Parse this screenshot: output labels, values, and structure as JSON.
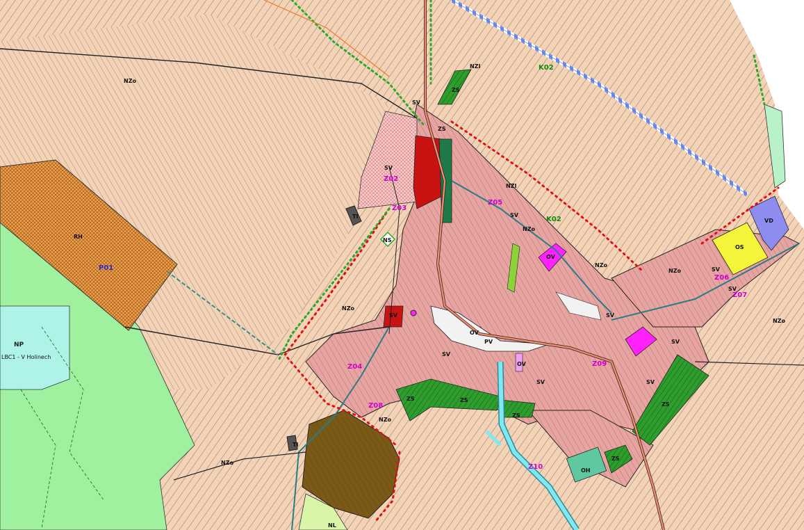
{
  "colors": {
    "agricultural": "#f3d2b6",
    "village": "#e8a4a0",
    "village_dense": "#e07b7b",
    "green_dark": "#2e9d2e",
    "green_light": "#9ff09f",
    "green_pale": "#b9f2c8",
    "nature_cyan": "#aff2e8",
    "brown_quarry": "#7a5a16",
    "orange_hatch": "#f0a04a",
    "red_block": "#c91212",
    "magenta": "#ff22ff",
    "yellow": "#f4f43a",
    "purple": "#8d8df0",
    "stream": "#7fe8f0",
    "boundary_red": "#e01010",
    "boundary_green": "#2aa82a",
    "road": "#f08a6a"
  },
  "labels": {
    "nzo": [
      "NZo",
      "NZo",
      "NZo",
      "NZo",
      "NZo",
      "NZo",
      "NZo",
      "NZo"
    ],
    "nzi": [
      "NZI",
      "NZI"
    ],
    "sv": [
      "SV",
      "SV",
      "SV",
      "SV",
      "SV",
      "SV",
      "SV",
      "SV",
      "SV",
      "SV",
      "SV"
    ],
    "zs": [
      "ZS",
      "ZS",
      "ZS",
      "ZS",
      "ZS",
      "ZS",
      "ZS"
    ],
    "ns": "NS",
    "ti": [
      "TI",
      "TI"
    ],
    "pv": "PV",
    "ov": [
      "OV",
      "OV",
      "OV"
    ],
    "os": "OS",
    "vd": "VD",
    "oh": "OH",
    "rh": "RH",
    "np": "NP",
    "lbc": "LBC1 - V Holinech",
    "nl": "NL",
    "k02": [
      "K02",
      "K02"
    ],
    "p01": "P01",
    "z": [
      "Z02",
      "Z03",
      "Z05",
      "Z06",
      "Z07",
      "Z04",
      "Z08",
      "Z09",
      "Z10"
    ]
  }
}
